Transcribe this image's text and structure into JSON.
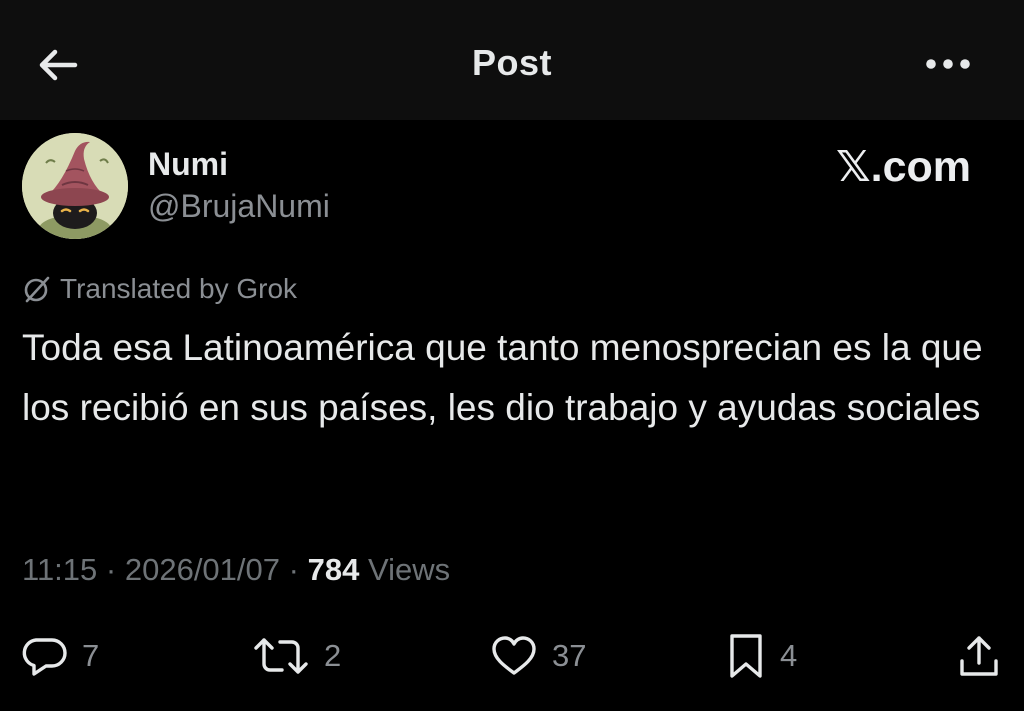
{
  "header": {
    "title": "Post"
  },
  "author": {
    "display_name": "Numi",
    "handle": "@BrujaNumi"
  },
  "watermark": "𝕏.com",
  "post": {
    "translated_label": "Translated by Grok",
    "text": "Toda esa Latinoamérica que tanto menosprecian es la que los recibió en sus países, les dio trabajo y ayudas sociales",
    "time": "11:15",
    "separator": "·",
    "date": "2026/01/07",
    "views_count": "784",
    "views_label": "Views"
  },
  "actions": {
    "replies": "7",
    "reposts": "2",
    "likes": "37",
    "bookmarks": "4"
  },
  "icons": {
    "back": "arrow-left-icon",
    "more": "more-dots-icon",
    "translate": "grok-icon",
    "reply": "reply-icon",
    "repost": "repost-icon",
    "like": "heart-icon",
    "bookmark": "bookmark-icon",
    "share": "share-icon"
  },
  "colors": {
    "background": "#000000",
    "header_background": "#0e0e0e",
    "primary_text": "#e7e9ea",
    "secondary_text": "#8b8f94"
  }
}
